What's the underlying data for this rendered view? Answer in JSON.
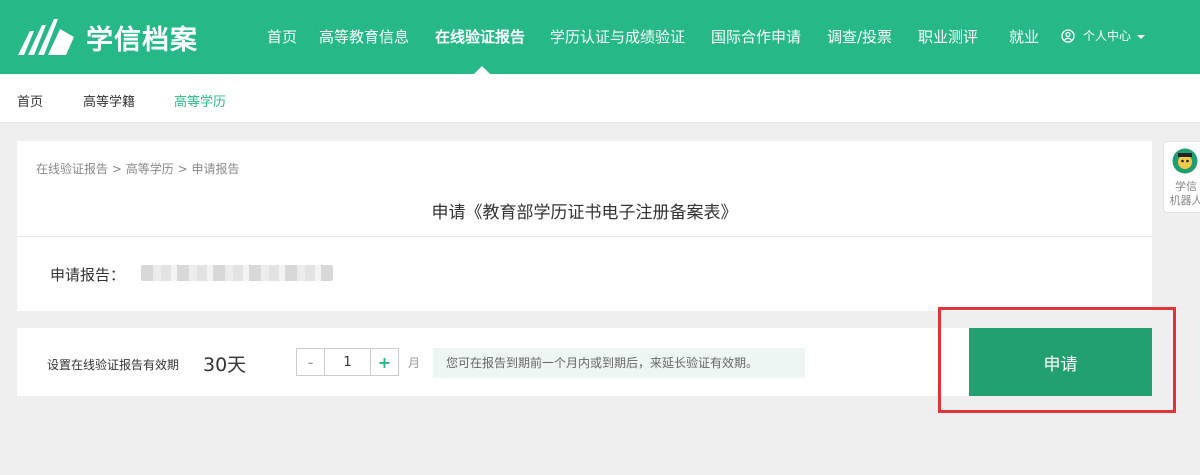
{
  "header": {
    "logo_text": "学信档案",
    "nav": [
      {
        "label": "首页"
      },
      {
        "label": "高等教育信息"
      },
      {
        "label": "在线验证报告",
        "active": true
      },
      {
        "label": "学历认证与成绩验证"
      },
      {
        "label": "国际合作申请"
      },
      {
        "label": "调查/投票"
      },
      {
        "label": "职业测评"
      },
      {
        "label": "就业"
      }
    ],
    "user_center_label": "个人中心"
  },
  "subnav": [
    {
      "label": "首页"
    },
    {
      "label": "高等学籍"
    },
    {
      "label": "高等学历",
      "active": true
    }
  ],
  "breadcrumb": [
    "在线验证报告",
    "高等学历",
    "申请报告"
  ],
  "breadcrumb_separator": ">",
  "page_title": "申请《教育部学历证书电子注册备案表》",
  "report": {
    "label": "申请报告："
  },
  "validity": {
    "label": "设置在线验证报告有效期",
    "value": "30天",
    "stepper_value": "1",
    "minus_symbol": "-",
    "plus_symbol": "+",
    "unit": "月",
    "hint": "您可在报告到期前一个月内或到期后，来延长验证有效期。"
  },
  "apply_button": "申请",
  "robot": {
    "line1": "学信",
    "line2": "机器人"
  },
  "colors": {
    "brand": "#26b887",
    "button": "#22a070",
    "highlight": "#e0333a"
  }
}
